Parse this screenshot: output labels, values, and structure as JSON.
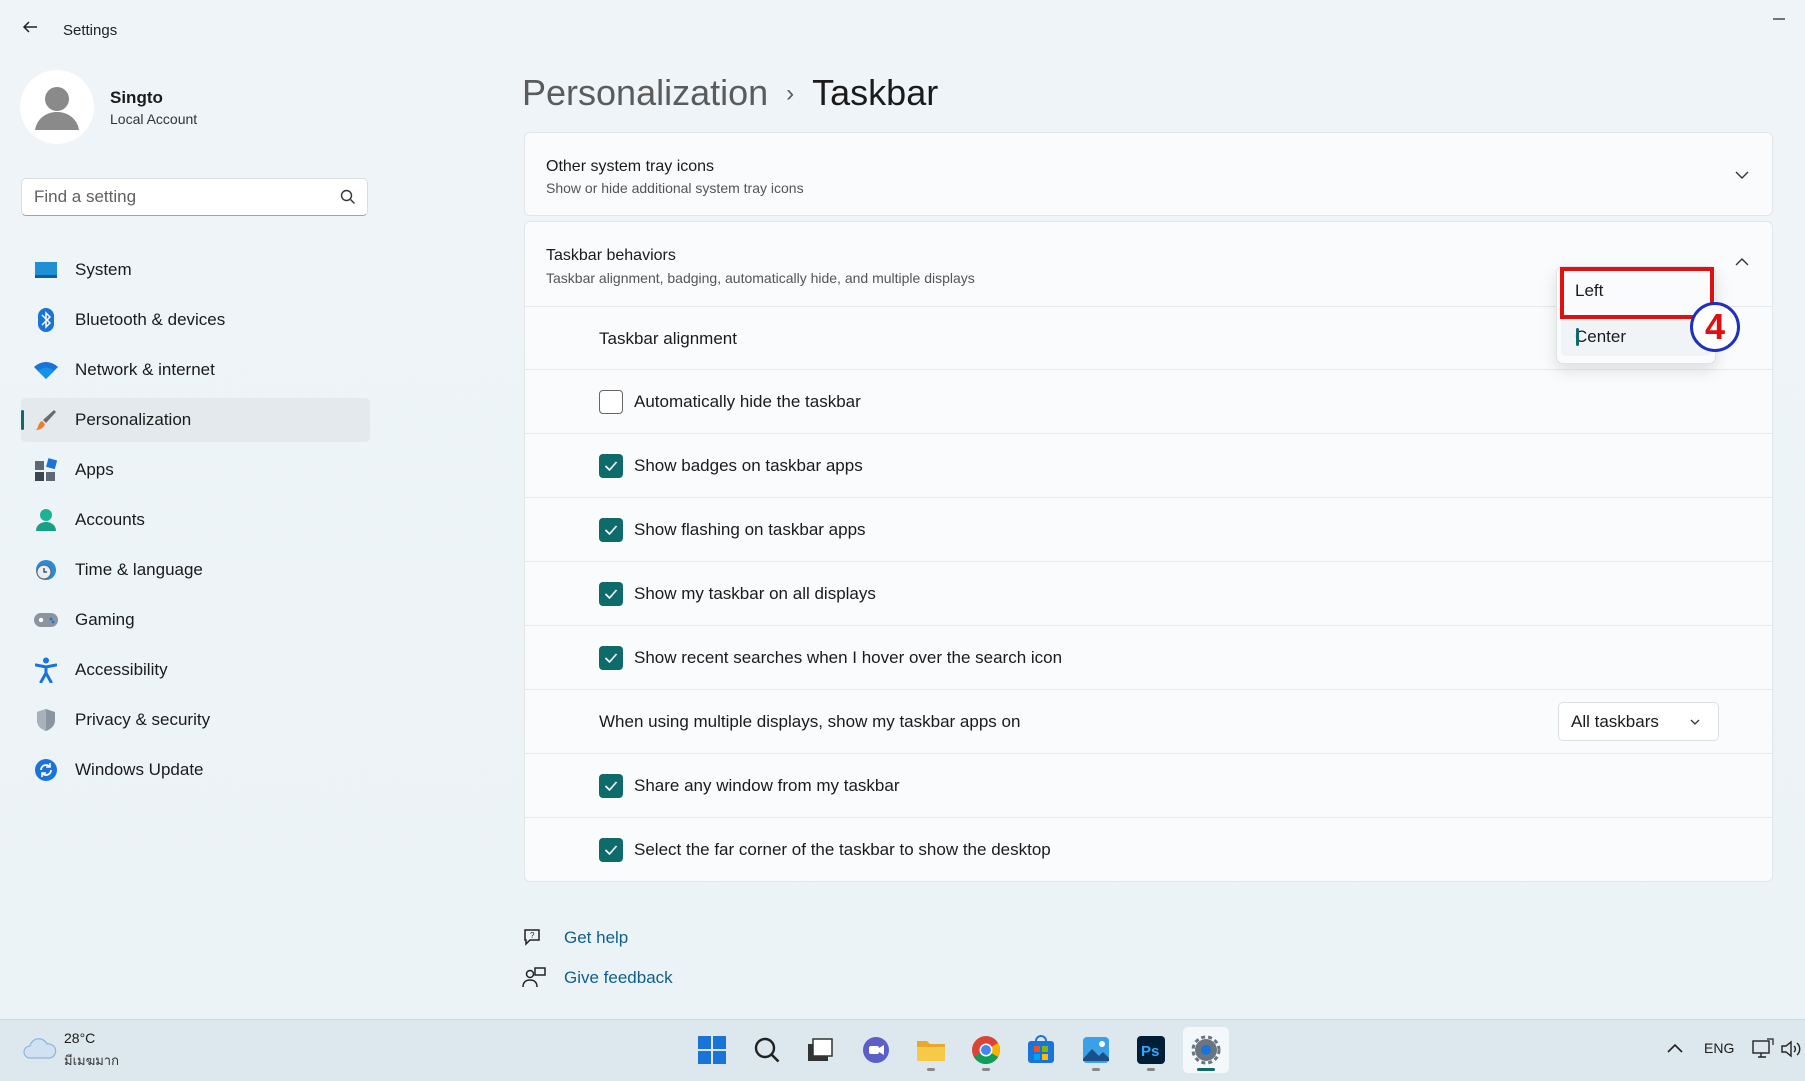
{
  "window": {
    "title": "Settings",
    "back_icon": "arrow-left-icon",
    "minimize_icon": "minimize-icon"
  },
  "user": {
    "name": "Singto",
    "account_type": "Local Account"
  },
  "search": {
    "placeholder": "Find a setting"
  },
  "sidebar": {
    "items": [
      {
        "label": "System",
        "icon": "system-icon",
        "selected": false
      },
      {
        "label": "Bluetooth & devices",
        "icon": "bluetooth-icon",
        "selected": false
      },
      {
        "label": "Network & internet",
        "icon": "wifi-icon",
        "selected": false
      },
      {
        "label": "Personalization",
        "icon": "brush-icon",
        "selected": true
      },
      {
        "label": "Apps",
        "icon": "apps-icon",
        "selected": false
      },
      {
        "label": "Accounts",
        "icon": "accounts-icon",
        "selected": false
      },
      {
        "label": "Time & language",
        "icon": "clock-globe-icon",
        "selected": false
      },
      {
        "label": "Gaming",
        "icon": "gamepad-icon",
        "selected": false
      },
      {
        "label": "Accessibility",
        "icon": "accessibility-icon",
        "selected": false
      },
      {
        "label": "Privacy & security",
        "icon": "shield-icon",
        "selected": false
      },
      {
        "label": "Windows Update",
        "icon": "update-icon",
        "selected": false
      }
    ]
  },
  "breadcrumb": {
    "parent": "Personalization",
    "separator": "›",
    "current": "Taskbar"
  },
  "tray_icons_card": {
    "title": "Other system tray icons",
    "subtitle": "Show or hide additional system tray icons"
  },
  "behaviors_card": {
    "title": "Taskbar behaviors",
    "subtitle": "Taskbar alignment, badging, automatically hide, and multiple displays",
    "alignment_label": "Taskbar alignment",
    "alignment_options": [
      "Left",
      "Center"
    ],
    "alignment_selected": "Center",
    "checkboxes": [
      {
        "label": "Automatically hide the taskbar",
        "checked": false
      },
      {
        "label": "Show badges on taskbar apps",
        "checked": true
      },
      {
        "label": "Show flashing on taskbar apps",
        "checked": true
      },
      {
        "label": "Show my taskbar on all displays",
        "checked": true
      },
      {
        "label": "Show recent searches when I hover over the search icon",
        "checked": true
      }
    ],
    "multi_display_label": "When using multiple displays, show my taskbar apps on",
    "multi_display_value": "All taskbars",
    "checkboxes_after": [
      {
        "label": "Share any window from my taskbar",
        "checked": true
      },
      {
        "label": "Select the far corner of the taskbar to show the desktop",
        "checked": true
      }
    ]
  },
  "annotation": {
    "step_number": "4",
    "highlight_color": "#e01010",
    "badge_ring_color": "#1f2fbf"
  },
  "help": {
    "get_help": "Get help",
    "give_feedback": "Give feedback"
  },
  "taskbar": {
    "weather": {
      "temp": "28°C",
      "desc": "มีเมฆมาก"
    },
    "apps": [
      "start-icon",
      "search-icon",
      "task-view-icon",
      "chat-icon",
      "file-explorer-icon",
      "chrome-icon",
      "store-icon",
      "photos-icon",
      "photoshop-icon",
      "settings-icon"
    ],
    "photoshop_text": "Ps",
    "tray": {
      "language": "ENG"
    }
  },
  "colors": {
    "accent": "#0f6b6b",
    "link": "#0f5f8a"
  }
}
